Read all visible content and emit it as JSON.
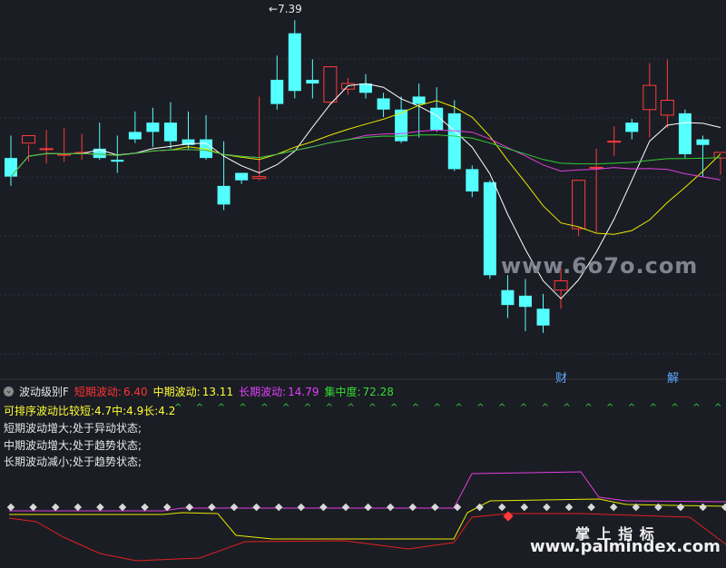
{
  "price": {
    "high_label": "7.39"
  },
  "events": [
    {
      "label": "财"
    },
    {
      "label": "解"
    }
  ],
  "indicator": {
    "name": "波动级别F",
    "short": {
      "label": "短期波动:",
      "value": "6.40",
      "color": "#ff3333"
    },
    "mid": {
      "label": "中期波动:",
      "value": "13.11",
      "color": "#ffff33"
    },
    "long": {
      "label": "长期波动:",
      "value": "14.79",
      "color": "#e040fb"
    },
    "conc": {
      "label": "集中度:",
      "value": "72.28",
      "color": "#33dd33"
    },
    "compare": "可排序波动比较短:4.7中:4.9长:4.2",
    "status1": "短期波动增大;处于异动状态;",
    "status2": "中期波动增大;处于趋势状态;",
    "status3": "长期波动减小;处于趋势状态;"
  },
  "watermarks": {
    "w1": "www.6o7o.com",
    "w2a": "掌 上 指 标",
    "w2b": "www.palmindex.com"
  },
  "colors": {
    "up": "#ff3b3b",
    "down": "#54ffff",
    "ma_white": "#ffffff",
    "ma_yellow": "#e8e800",
    "ma_magenta": "#e040e0",
    "ma_green": "#33cc33"
  },
  "chart_data": {
    "type": "candlestick",
    "ylim": [
      5.5,
      7.45
    ],
    "candles": [
      [
        6.65,
        6.77,
        6.55,
        6.5
      ],
      [
        6.73,
        6.72,
        6.77,
        6.63
      ],
      [
        6.7,
        6.8,
        6.7,
        6.62
      ],
      [
        6.67,
        6.81,
        6.67,
        6.63
      ],
      [
        6.68,
        6.78,
        6.68,
        6.64
      ],
      [
        6.7,
        6.84,
        6.65,
        6.64
      ],
      [
        6.64,
        6.77,
        6.63,
        6.57
      ],
      [
        6.79,
        6.9,
        6.75,
        6.73
      ],
      [
        6.84,
        6.92,
        6.79,
        6.71
      ],
      [
        6.84,
        6.95,
        6.74,
        6.7
      ],
      [
        6.75,
        6.9,
        6.72,
        6.7
      ],
      [
        6.75,
        6.88,
        6.65,
        6.64
      ],
      [
        6.5,
        6.74,
        6.4,
        6.37
      ],
      [
        6.57,
        6.56,
        6.53,
        6.51
      ],
      [
        6.54,
        6.98,
        6.55,
        6.53
      ],
      [
        7.07,
        7.2,
        6.94,
        6.91
      ],
      [
        7.32,
        7.39,
        7.01,
        6.97
      ],
      [
        7.07,
        7.18,
        7.05,
        6.97
      ],
      [
        6.95,
        7.13,
        7.14,
        6.94
      ],
      [
        7.02,
        7.08,
        7.05,
        6.99
      ],
      [
        7.05,
        7.1,
        7.0,
        6.97
      ],
      [
        6.97,
        7.0,
        6.91,
        6.87
      ],
      [
        6.91,
        6.98,
        6.74,
        6.73
      ],
      [
        6.98,
        7.05,
        6.94,
        6.76
      ],
      [
        6.92,
        7.03,
        6.8,
        6.79
      ],
      [
        6.89,
        6.96,
        6.59,
        6.58
      ],
      [
        6.59,
        6.61,
        6.47,
        6.44
      ],
      [
        6.52,
        6.53,
        6.02,
        6.0
      ],
      [
        5.94,
        6.02,
        5.86,
        5.79
      ],
      [
        5.91,
        6.0,
        5.85,
        5.72
      ],
      [
        5.84,
        5.92,
        5.75,
        5.71
      ],
      [
        5.94,
        6.06,
        5.99,
        5.84
      ],
      [
        6.27,
        6.34,
        6.53,
        6.23
      ],
      [
        6.6,
        6.7,
        6.6,
        6.25
      ],
      [
        6.74,
        6.82,
        6.74,
        6.66
      ],
      [
        6.84,
        6.86,
        6.79,
        6.75
      ],
      [
        6.91,
        7.16,
        7.04,
        6.76
      ],
      [
        6.88,
        7.18,
        6.96,
        6.81
      ],
      [
        6.89,
        6.91,
        6.67,
        6.65
      ],
      [
        6.75,
        6.77,
        6.72,
        6.55
      ],
      [
        6.65,
        6.68,
        6.68,
        6.56
      ]
    ]
  }
}
